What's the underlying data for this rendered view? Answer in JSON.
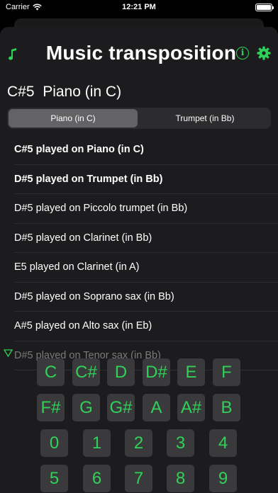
{
  "status_bar": {
    "carrier": "Carrier",
    "time": "12:21 PM"
  },
  "header": {
    "title": "Music transposition",
    "music_icon": "music-note-icon",
    "info_icon": "info-icon",
    "settings_icon": "gear-icon"
  },
  "selection": {
    "note": "C#5",
    "instrument": "Piano (in C)"
  },
  "segments": [
    "Piano (in C)",
    "Trumpet (in Bb)"
  ],
  "results": [
    "C#5 played on Piano (in C)",
    "D#5 played on Trumpet (in Bb)",
    "D#5 played on Piccolo trumpet (in Bb)",
    "D#5 played on Clarinet (in Bb)",
    "E5 played on Clarinet (in A)",
    "D#5 played on Soprano sax (in Bb)",
    "A#5 played on Alto sax (in Eb)",
    "D#5 played on Tenor sax (in Bb)"
  ],
  "keypad": {
    "notes_row1": [
      "C",
      "C#",
      "D",
      "D#",
      "E",
      "F"
    ],
    "notes_row2": [
      "F#",
      "G",
      "G#",
      "A",
      "A#",
      "B"
    ],
    "digits_row1": [
      "0",
      "1",
      "2",
      "3",
      "4"
    ],
    "digits_row2": [
      "5",
      "6",
      "7",
      "8",
      "9"
    ]
  },
  "colors": {
    "accent": "#30d158",
    "background": "#1c1c1e",
    "key": "#3a3a3c"
  }
}
